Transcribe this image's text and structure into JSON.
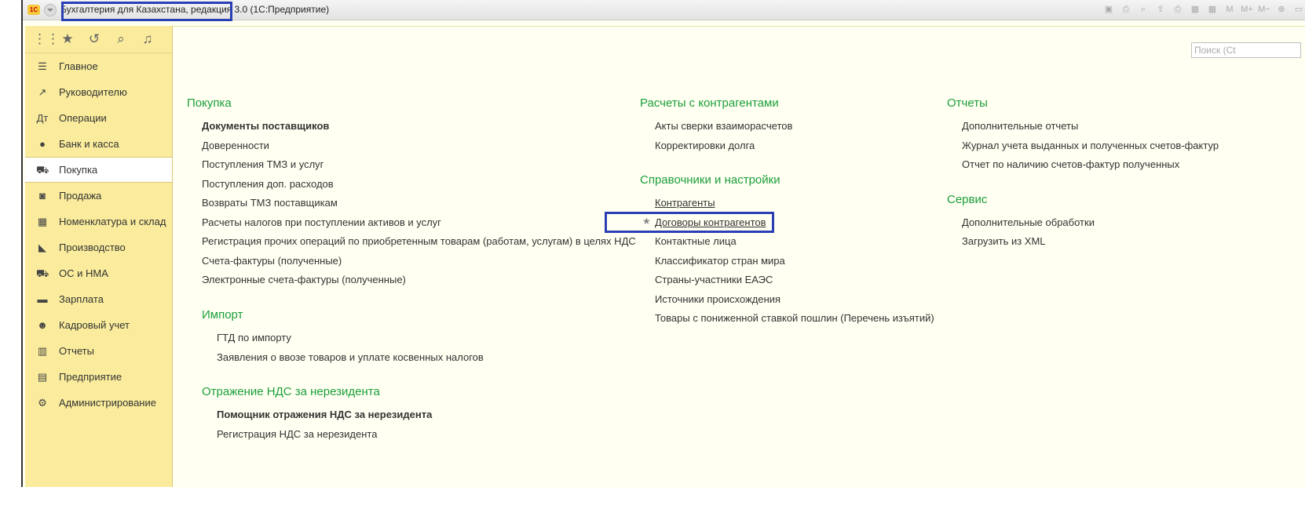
{
  "titlebar": {
    "logo_text": "1С",
    "app_name": "Бухгалтерия для Казахстана, редакция 3.0",
    "app_suffix": "(1С:Предприятие)",
    "tools": [
      "save-icon",
      "print-icon",
      "preview-icon",
      "upload-icon",
      "print2-icon",
      "calculator-icon",
      "calendar-icon",
      "M",
      "M+",
      "M−",
      "zoom-icon",
      "window-icon"
    ],
    "tool_labels": [
      "▣",
      "⎙",
      "⌕",
      "⇪",
      "⎙",
      "▦",
      "▦",
      "M",
      "M+",
      "M−",
      "⊕",
      "▭"
    ]
  },
  "sidebar": {
    "top_icons": [
      "⋮⋮",
      "★",
      "↺",
      "⌕",
      "♫"
    ],
    "items": [
      {
        "label": "Главное",
        "icon": "☰"
      },
      {
        "label": "Руководителю",
        "icon": "↗"
      },
      {
        "label": "Операции",
        "icon": "Дт"
      },
      {
        "label": "Банк и касса",
        "icon": "●"
      },
      {
        "label": "Покупка",
        "icon": "⛟"
      },
      {
        "label": "Продажа",
        "icon": "◙"
      },
      {
        "label": "Номенклатура и склад",
        "icon": "▦"
      },
      {
        "label": "Производство",
        "icon": "◣"
      },
      {
        "label": "ОС и НМА",
        "icon": "⛟"
      },
      {
        "label": "Зарплата",
        "icon": "▬"
      },
      {
        "label": "Кадровый учет",
        "icon": "☻"
      },
      {
        "label": "Отчеты",
        "icon": "▥"
      },
      {
        "label": "Предприятие",
        "icon": "▤"
      },
      {
        "label": "Администрирование",
        "icon": "⚙"
      }
    ]
  },
  "search": {
    "placeholder": "Поиск (Ct"
  },
  "columns": {
    "purchase": {
      "title": "Покупка",
      "links": [
        "Документы поставщиков",
        "Доверенности",
        "Поступления ТМЗ и услуг",
        "Поступления доп. расходов",
        "Возвраты ТМЗ поставщикам",
        "Расчеты налогов при поступлении активов и услуг",
        "Регистрация прочих операций по приобретенным товарам (работам, услугам) в целях НДС",
        "Счета-фактуры (полученные)",
        "Электронные счета-фактуры (полученные)"
      ]
    },
    "import": {
      "title": "Импорт",
      "links": [
        "ГТД по импорту",
        "Заявления о ввозе товаров и уплате косвенных налогов"
      ]
    },
    "vat_nonresident": {
      "title": "Отражение НДС за нерезидента",
      "links": [
        "Помощник отражения НДС за нерезидента",
        "Регистрация НДС за нерезидента"
      ]
    },
    "settlements": {
      "title": "Расчеты с контрагентами",
      "links": [
        "Акты сверки взаиморасчетов",
        "Корректировки долга"
      ]
    },
    "references": {
      "title": "Справочники и настройки",
      "links": [
        "Контрагенты",
        "Договоры контрагентов",
        "Контактные лица",
        "Классификатор стран мира",
        "Страны-участники ЕАЭС",
        "Источники происхождения",
        "Товары с пониженной ставкой пошлин (Перечень изъятий)"
      ]
    },
    "reports": {
      "title": "Отчеты",
      "links": [
        "Дополнительные отчеты",
        "Журнал учета выданных и полученных счетов-фактур",
        "Отчет по наличию счетов-фактур полученных"
      ]
    },
    "service": {
      "title": "Сервис",
      "links": [
        "Дополнительные обработки",
        "Загрузить из XML"
      ]
    }
  }
}
